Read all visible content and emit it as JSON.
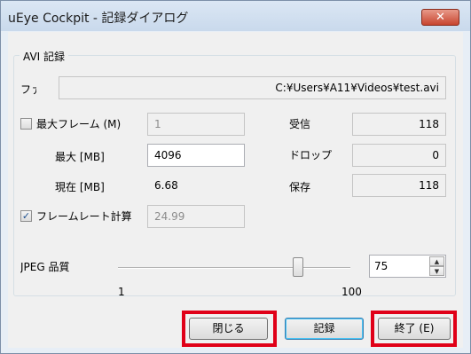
{
  "window": {
    "title": "uEye Cockpit - 記録ダイアログ",
    "close_glyph": "✕"
  },
  "group": {
    "label": "AVI 記録"
  },
  "file": {
    "label": "ファ",
    "path": "C:¥Users¥A11¥Videos¥test.avi"
  },
  "max_frames": {
    "label": "最大フレーム (M)",
    "checked": false,
    "value": "1"
  },
  "max_mb": {
    "label": "最大 [MB]",
    "value": "4096"
  },
  "current_mb": {
    "label": "現在 [MB]",
    "value": "6.68"
  },
  "stats": {
    "received_label": "受信",
    "received_value": "118",
    "dropped_label": "ドロップ",
    "dropped_value": "0",
    "saved_label": "保存",
    "saved_value": "118"
  },
  "framerate": {
    "label": "フレームレート計算",
    "checked": true,
    "check_glyph": "✓",
    "value": "24.99"
  },
  "jpeg": {
    "label": "JPEG 品質",
    "value": "75",
    "min_label": "1",
    "max_label": "100",
    "slider_value": 75,
    "up_glyph": "▲",
    "down_glyph": "▼"
  },
  "buttons": {
    "close_label": "閉じる",
    "record_label": "記録",
    "exit_label": "終了 (E)"
  },
  "colors": {
    "highlight": "#e00018",
    "accent": "#48c3f4"
  }
}
